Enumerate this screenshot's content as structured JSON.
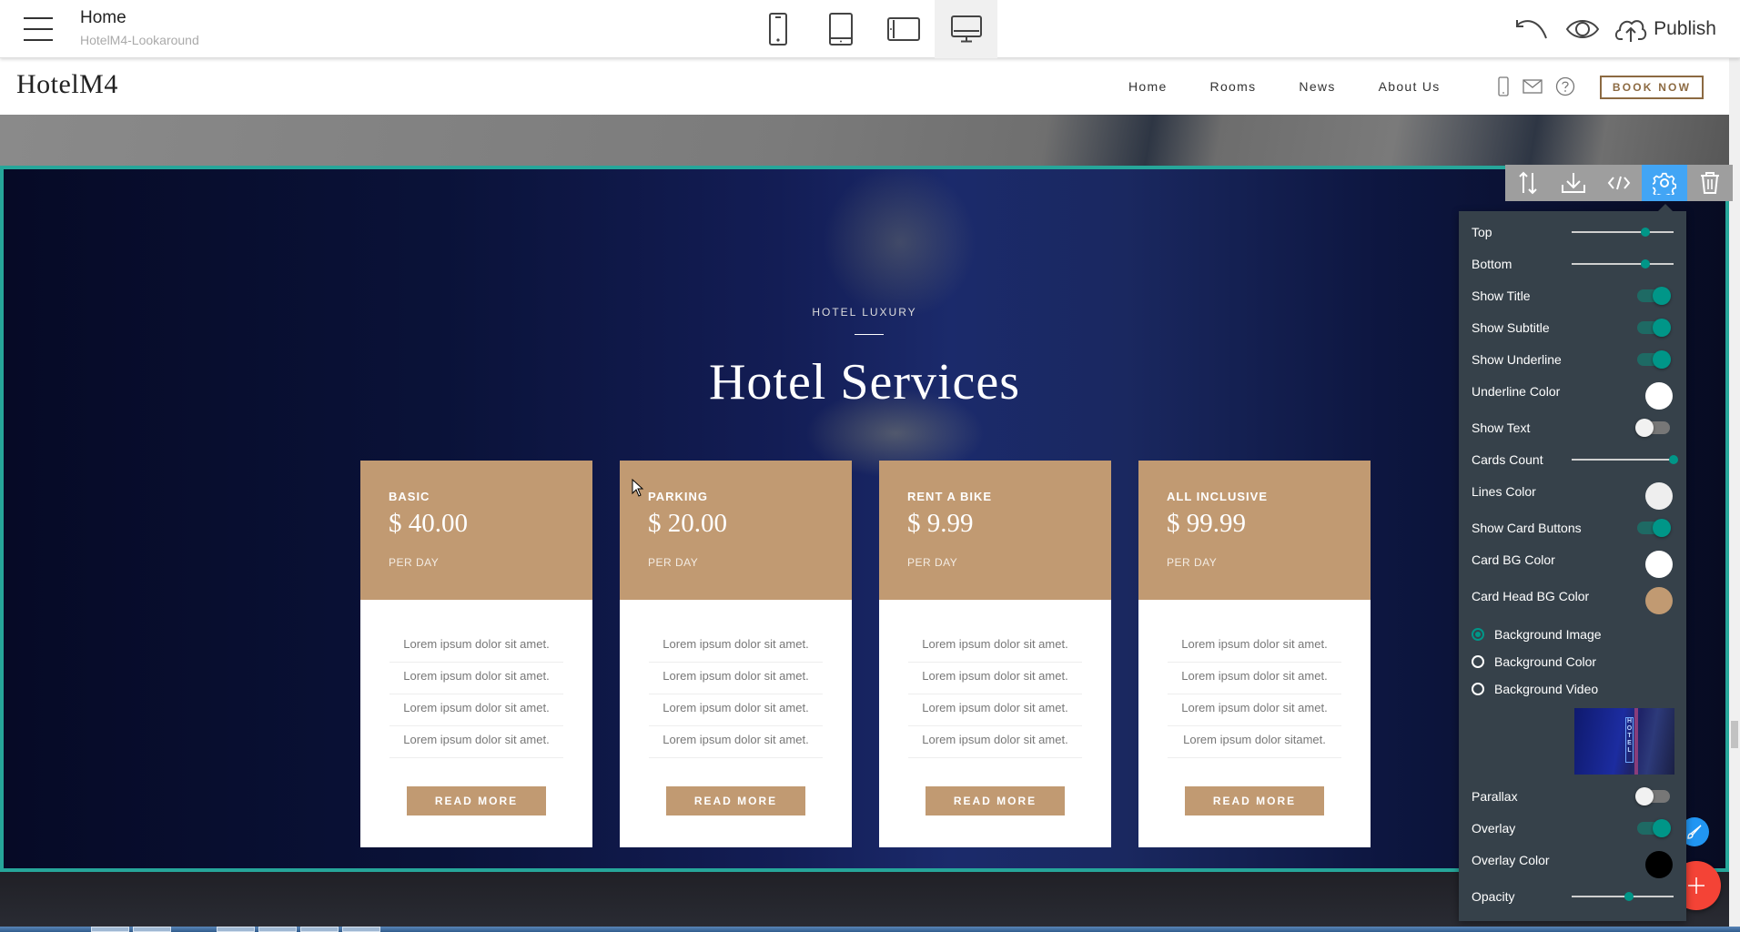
{
  "editor": {
    "page_title": "Home",
    "project_name": "HotelM4-Lookaround",
    "devices": [
      {
        "name": "mobile",
        "active": false
      },
      {
        "name": "tablet",
        "active": false
      },
      {
        "name": "tablet-landscape",
        "active": false
      },
      {
        "name": "desktop",
        "active": true
      }
    ],
    "publish_label": "Publish"
  },
  "site": {
    "logo": "HotelM4",
    "nav": [
      "Home",
      "Rooms",
      "News",
      "About Us"
    ],
    "book_now": "BOOK NOW"
  },
  "services": {
    "subtitle": "HOTEL LUXURY",
    "title": "Hotel Services",
    "cards": [
      {
        "name": "BASIC",
        "price": "$ 40.00",
        "per": "PER DAY",
        "lines": [
          "Lorem ipsum dolor sit amet.",
          "Lorem ipsum dolor sit amet.",
          "Lorem ipsum dolor sit amet.",
          "Lorem ipsum dolor sit amet."
        ],
        "button": "READ MORE"
      },
      {
        "name": "PARKING",
        "price": "$ 20.00",
        "per": "PER DAY",
        "lines": [
          "Lorem ipsum dolor sit amet.",
          "Lorem ipsum dolor sit amet.",
          "Lorem ipsum dolor sit amet.",
          "Lorem ipsum dolor sit amet."
        ],
        "button": "READ MORE"
      },
      {
        "name": "RENT A BIKE",
        "price": "$ 9.99",
        "per": "PER DAY",
        "lines": [
          "Lorem ipsum dolor sit amet.",
          "Lorem ipsum dolor sit amet.",
          "Lorem ipsum dolor sit amet.",
          "Lorem ipsum dolor sit amet."
        ],
        "button": "READ MORE"
      },
      {
        "name": "ALL INCLUSIVE",
        "price": "$ 99.99",
        "per": "PER DAY",
        "lines": [
          "Lorem ipsum dolor sit amet.",
          "Lorem ipsum dolor sit amet.",
          "Lorem ipsum dolor sit amet.",
          "Lorem ipsum dolor sitamet."
        ],
        "button": "READ MORE"
      }
    ]
  },
  "block_toolbar": [
    "move-icon",
    "download-icon",
    "code-icon",
    "gear-icon",
    "trash-icon"
  ],
  "settings": {
    "top": {
      "label": "Top",
      "value_fraction": 0.72
    },
    "bottom": {
      "label": "Bottom",
      "value_fraction": 0.72
    },
    "show_title": {
      "label": "Show Title",
      "on": true
    },
    "show_subtitle": {
      "label": "Show Subtitle",
      "on": true
    },
    "show_underline": {
      "label": "Show Underline",
      "on": true
    },
    "underline_color": {
      "label": "Underline Color",
      "color": "#ffffff"
    },
    "show_text": {
      "label": "Show Text",
      "on": false
    },
    "cards_count": {
      "label": "Cards Count",
      "value_fraction": 1.0
    },
    "lines_color": {
      "label": "Lines Color",
      "color": "#eeeeee"
    },
    "show_card_buttons": {
      "label": "Show Card Buttons",
      "on": true
    },
    "card_bg_color": {
      "label": "Card BG Color",
      "color": "#ffffff"
    },
    "card_head_bg_color": {
      "label": "Card Head BG Color",
      "color": "#c19a72"
    },
    "background": {
      "options": [
        "Background Image",
        "Background Color",
        "Background Video"
      ],
      "selected": "Background Image",
      "thumb_text": "HOTEL"
    },
    "parallax": {
      "label": "Parallax",
      "on": false
    },
    "overlay": {
      "label": "Overlay",
      "on": true
    },
    "overlay_color": {
      "label": "Overlay Color",
      "color": "#000000"
    },
    "opacity": {
      "label": "Opacity",
      "value_fraction": 0.56
    }
  },
  "colors": {
    "accent": "#26a69a",
    "toggle": "#009688",
    "card_head": "#c19a72",
    "active_tool": "#42a5f5",
    "fab_add": "#f44336",
    "fab_edit": "#2196f3"
  }
}
